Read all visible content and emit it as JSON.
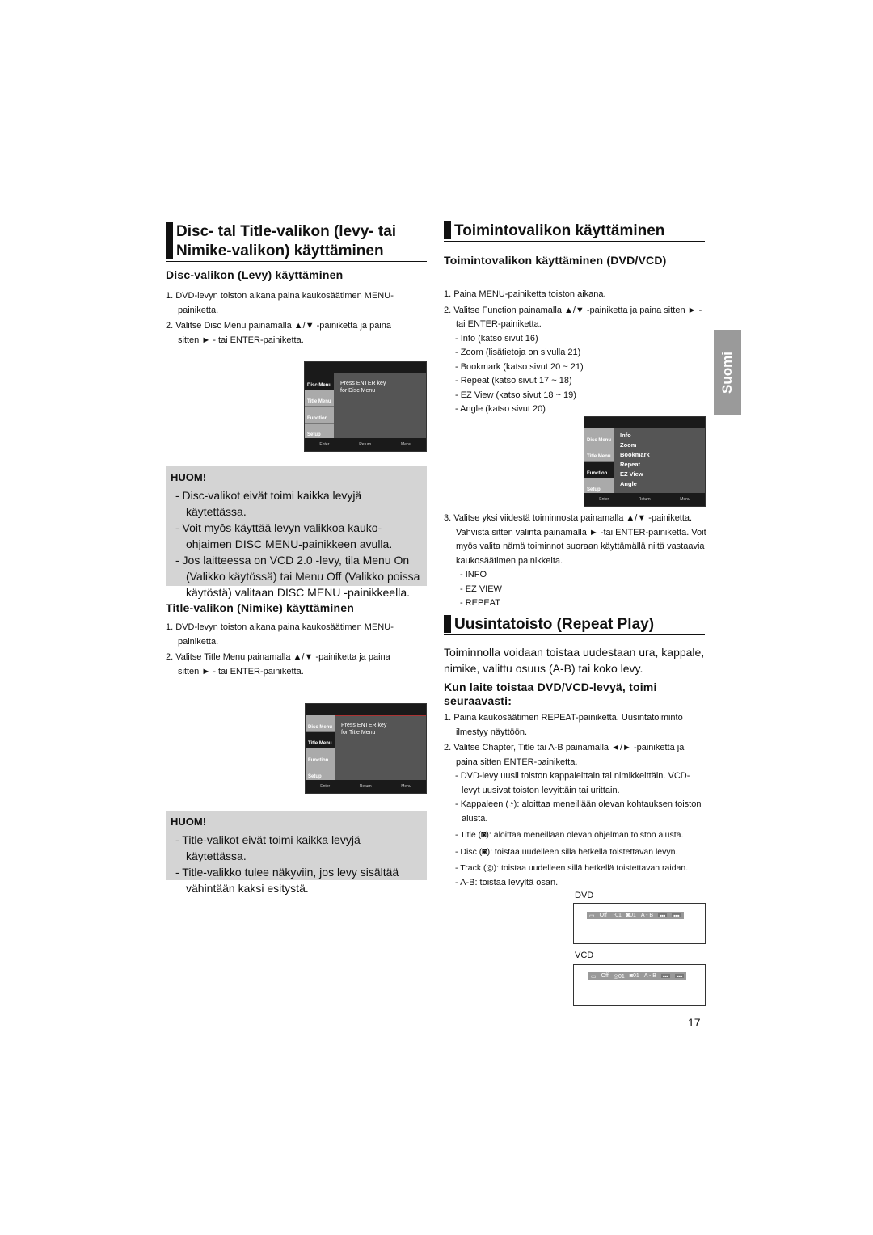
{
  "left": {
    "heading": [
      "Disc- tal Title-valikon (levy- tai",
      "Nimike-valikon) käyttäminen"
    ],
    "disc_sub": "Disc-valikon (Levy) käyttäminen",
    "disc_steps": [
      "1. DVD-levyn toiston aikana paina kaukosäätimen MENU-painiketta.",
      "2. Valitse Disc Menu painamalla ▲/▼ -painiketta ja paina sitten ► - tai ENTER-painiketta."
    ],
    "disc_screen": {
      "items": [
        "Disc Menu",
        "Title Menu",
        "Function",
        "Setup"
      ],
      "message": [
        "Press ENTER key",
        "for Disc Menu"
      ],
      "footer": [
        "Enter",
        "Return",
        "Menu"
      ]
    },
    "note1": {
      "title": "HUOM!",
      "items": [
        "- Disc-valikot eivät toimi kaikka levyjä käytettässa.",
        "- Voit myôs käyttää levyn valikkoa kauko-ohjaimen DISC MENU-painikkeen avulla.",
        "- Jos laitteessa on VCD 2.0 -levy, tila Menu On (Valikko käytössä) tai Menu Off (Valikko poissa käytöstä) valitaan DISC MENU -painikkeella."
      ]
    },
    "title_sub": "Title-valikon (Nimike) käyttäminen",
    "title_steps": [
      "1. DVD-levyn toiston aikana paina kaukosäätimen MENU-painiketta.",
      "2. Valitse Title Menu painamalla ▲/▼ -painiketta ja paina sitten ► - tai ENTER-painiketta."
    ],
    "title_screen": {
      "items": [
        "Disc Menu",
        "Title Menu",
        "Function",
        "Setup"
      ],
      "message": [
        "Press ENTER key",
        "for Title Menu"
      ],
      "footer": [
        "Enter",
        "Return",
        "Menu"
      ]
    },
    "note2": {
      "title": "HUOM!",
      "items": [
        "- Title-valikot eivät toimi kaikka levyjä käytettässa.",
        "- Title-valikko tulee näkyviin, jos levy sisältää vähintään kaksi esitystä."
      ]
    }
  },
  "right": {
    "heading": "Toimintovalikon käyttäminen",
    "sub": "Toimintovalikon käyttäminen (DVD/VCD)",
    "steps": [
      "1. Paina MENU-painiketta toiston aikana.",
      "2. Valitse Function painamalla ▲/▼ -painiketta ja paina sitten ► - tai ENTER-painiketta."
    ],
    "functions": [
      "- Info (katso sivut 16)",
      "- Zoom (lisätietoja on sivulla 21)",
      "- Bookmark (katso sivut  20 ~ 21)",
      "- Repeat (katso sivut 17 ~ 18)",
      "- EZ View (katso sivut 18 ~ 19)",
      "- Angle (katso sivut 20)"
    ],
    "screen": {
      "items": [
        "Disc Menu",
        "Title Menu",
        "Function",
        "Setup"
      ],
      "menu": [
        "Info",
        "Zoom",
        "Bookmark",
        "Repeat",
        "EZ View",
        "Angle"
      ],
      "footer": [
        "Enter",
        "Return",
        "Menu"
      ]
    },
    "step3": "3. Valitse yksi viidestä toiminnosta painamalla ▲/▼ -painiketta. Vahvista sitten valinta painamalla ► -tai ENTER-painiketta. Voit myös valita nämä toiminnot suoraan käyttämällä niitä vastaavia kaukosäätimen painikkeita.",
    "buttons": [
      "- INFO",
      "- EZ VIEW",
      "- REPEAT"
    ],
    "repeat_heading": "Uusintatoisto (Repeat Play)",
    "repeat_intro": "Toiminnolla voidaan toistaa uudestaan ura, kappale, nimike, valittu osuus (A-B) tai koko levy.",
    "repeat_sub": "Kun laite toistaa DVD/VCD-levyä, toimi seuraavasti:",
    "repeat_steps": [
      "1. Paina kaukosäätimen REPEAT-painiketta. Uusintatoiminto ilmestyy näyttöön.",
      "2. Valitse Chapter, Title tai A-B painamalla ◄/► -painiketta ja paina sitten ENTER-painiketta."
    ],
    "repeat_notes": [
      "- DVD-levy uusii toiston kappaleittain tai nimikkeittäin. VCD-levyt uusivat toiston levyittäin tai urittain.",
      "- Kappaleen (◔): aloittaa meneillään olevan kohtauksen toiston alusta.",
      "- Title (◙): aloittaa meneillään olevan ohjelman toiston alusta.",
      "- Disc (◙): toistaa uudelleen sillä hetkellä toistettavan levyn.",
      "- Track (◎): toistaa uudelleen sillä hetkellä toistettavan raidan.",
      "- A-B: toistaa levyltä osan."
    ],
    "dvd_label": "DVD",
    "dvd_osd": [
      "Off",
      "01",
      "01",
      "A - B"
    ],
    "vcd_label": "VCD",
    "vcd_osd": [
      "Off",
      "01",
      "01",
      "A - B"
    ]
  },
  "side_tab": "Suomi",
  "page_number": "17"
}
